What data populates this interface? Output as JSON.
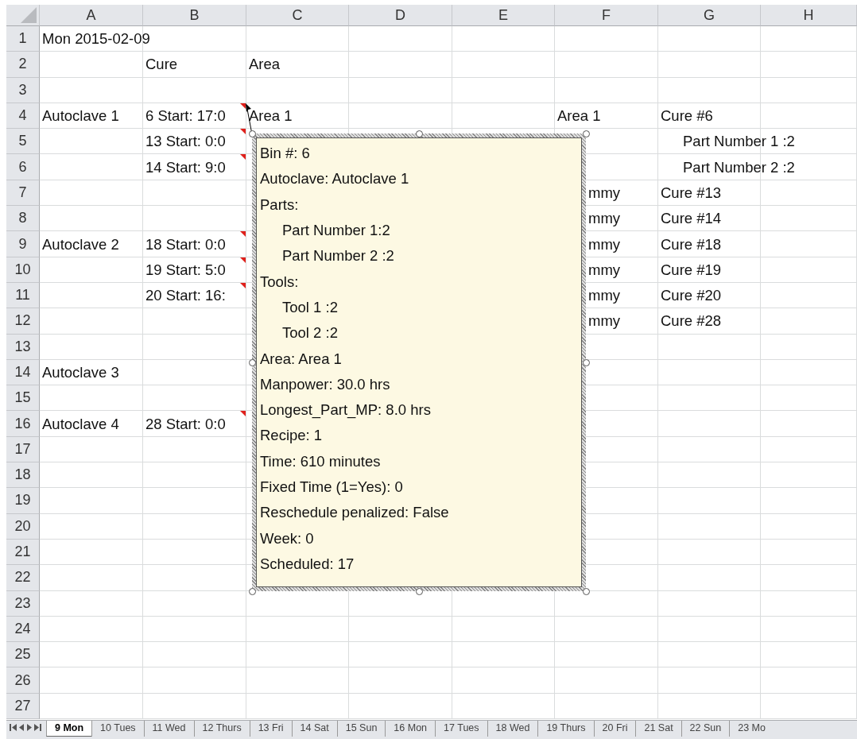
{
  "columns": [
    "A",
    "B",
    "C",
    "D",
    "E",
    "F",
    "G",
    "H"
  ],
  "rows": [
    {
      "number": "1",
      "A": {
        "text": "Mon 2015-02-09",
        "note": false,
        "kind": "text"
      }
    },
    {
      "number": "2",
      "B": {
        "text": "Cure",
        "note": false,
        "kind": "text"
      },
      "C": {
        "text": "Area",
        "note": false,
        "kind": "text"
      }
    },
    {
      "number": "3"
    },
    {
      "number": "4",
      "A": {
        "text": "Autoclave 1",
        "note": false,
        "kind": "text"
      },
      "B": {
        "text": "6 Start: 17:0",
        "note": true,
        "kind": "text"
      },
      "C": {
        "text": "Area 1",
        "note": false,
        "kind": "text"
      },
      "F": {
        "text": "Area 1",
        "note": false,
        "kind": "text"
      },
      "G": {
        "text": "Cure #6",
        "note": false,
        "kind": "text"
      }
    },
    {
      "number": "5",
      "B": {
        "text": "13 Start: 0:0",
        "note": true,
        "kind": "text"
      },
      "G": {
        "text": "Part Number 1 :2",
        "note": false,
        "kind": "indented"
      }
    },
    {
      "number": "6",
      "B": {
        "text": "14 Start: 9:0",
        "note": true,
        "kind": "text"
      },
      "G": {
        "text": "Part Number 2 :2",
        "note": false,
        "kind": "indented"
      }
    },
    {
      "number": "7",
      "F": {
        "text": "mmy",
        "note": false,
        "kind": "covered"
      },
      "G": {
        "text": "Cure #13",
        "note": false,
        "kind": "text"
      }
    },
    {
      "number": "8",
      "F": {
        "text": "mmy",
        "note": false,
        "kind": "covered"
      },
      "G": {
        "text": "Cure #14",
        "note": false,
        "kind": "text"
      }
    },
    {
      "number": "9",
      "A": {
        "text": "Autoclave 2",
        "note": false,
        "kind": "text"
      },
      "B": {
        "text": "18 Start: 0:0",
        "note": true,
        "kind": "text"
      },
      "F": {
        "text": "mmy",
        "note": false,
        "kind": "covered"
      },
      "G": {
        "text": "Cure #18",
        "note": false,
        "kind": "text"
      }
    },
    {
      "number": "10",
      "B": {
        "text": "19 Start: 5:0",
        "note": true,
        "kind": "text"
      },
      "F": {
        "text": "mmy",
        "note": false,
        "kind": "covered"
      },
      "G": {
        "text": "Cure #19",
        "note": false,
        "kind": "text"
      }
    },
    {
      "number": "11",
      "B": {
        "text": "20 Start: 16:",
        "note": true,
        "kind": "text"
      },
      "F": {
        "text": "mmy",
        "note": false,
        "kind": "covered"
      },
      "G": {
        "text": "Cure #20",
        "note": false,
        "kind": "text"
      }
    },
    {
      "number": "12",
      "F": {
        "text": "mmy",
        "note": false,
        "kind": "covered"
      },
      "G": {
        "text": "Cure #28",
        "note": false,
        "kind": "text"
      }
    },
    {
      "number": "13"
    },
    {
      "number": "14",
      "A": {
        "text": "Autoclave 3",
        "note": false,
        "kind": "text"
      }
    },
    {
      "number": "15"
    },
    {
      "number": "16",
      "A": {
        "text": "Autoclave 4",
        "note": false,
        "kind": "text"
      },
      "B": {
        "text": "28 Start: 0:0",
        "note": true,
        "kind": "text"
      }
    },
    {
      "number": "17"
    },
    {
      "number": "18"
    },
    {
      "number": "19"
    },
    {
      "number": "20"
    },
    {
      "number": "21"
    },
    {
      "number": "22"
    },
    {
      "number": "23"
    },
    {
      "number": "24"
    },
    {
      "number": "25"
    },
    {
      "number": "26"
    },
    {
      "number": "27"
    }
  ],
  "comment": {
    "lines": [
      {
        "text": "Bin #: 6"
      },
      {
        "text": "Autoclave: Autoclave 1"
      },
      {
        "text": "Parts:",
        "children": [
          {
            "text": "Part Number 1:2"
          },
          {
            "text": "Part Number 2 :2"
          }
        ]
      },
      {
        "text": "Tools:",
        "children": [
          {
            "text": "Tool 1 :2"
          },
          {
            "text": "Tool 2 :2"
          }
        ]
      },
      {
        "text": "Area: Area 1"
      },
      {
        "text": "Manpower: 30.0 hrs"
      },
      {
        "text": "Longest_Part_MP: 8.0 hrs"
      },
      {
        "text": "Recipe: 1"
      },
      {
        "text": "Time: 610 minutes"
      },
      {
        "text": "Fixed Time (1=Yes): 0"
      },
      {
        "text": "Reschedule penalized: False"
      },
      {
        "text": "Week: 0"
      },
      {
        "text": "Scheduled: 17"
      }
    ]
  },
  "sheet_tabs": [
    {
      "label": "9 Mon",
      "selected": true
    },
    {
      "label": "10 Tues",
      "selected": false
    },
    {
      "label": "11 Wed",
      "selected": false
    },
    {
      "label": "12 Thurs",
      "selected": false
    },
    {
      "label": "13 Fri",
      "selected": false
    },
    {
      "label": "14 Sat",
      "selected": false
    },
    {
      "label": "15 Sun",
      "selected": false
    },
    {
      "label": "16 Mon",
      "selected": false
    },
    {
      "label": "17 Tues",
      "selected": false
    },
    {
      "label": "18 Wed",
      "selected": false
    },
    {
      "label": "19 Thurs",
      "selected": false
    },
    {
      "label": "20 Fri",
      "selected": false
    },
    {
      "label": "21 Sat",
      "selected": false
    },
    {
      "label": "22 Sun",
      "selected": false
    },
    {
      "label": "23 Mo",
      "selected": false
    }
  ]
}
